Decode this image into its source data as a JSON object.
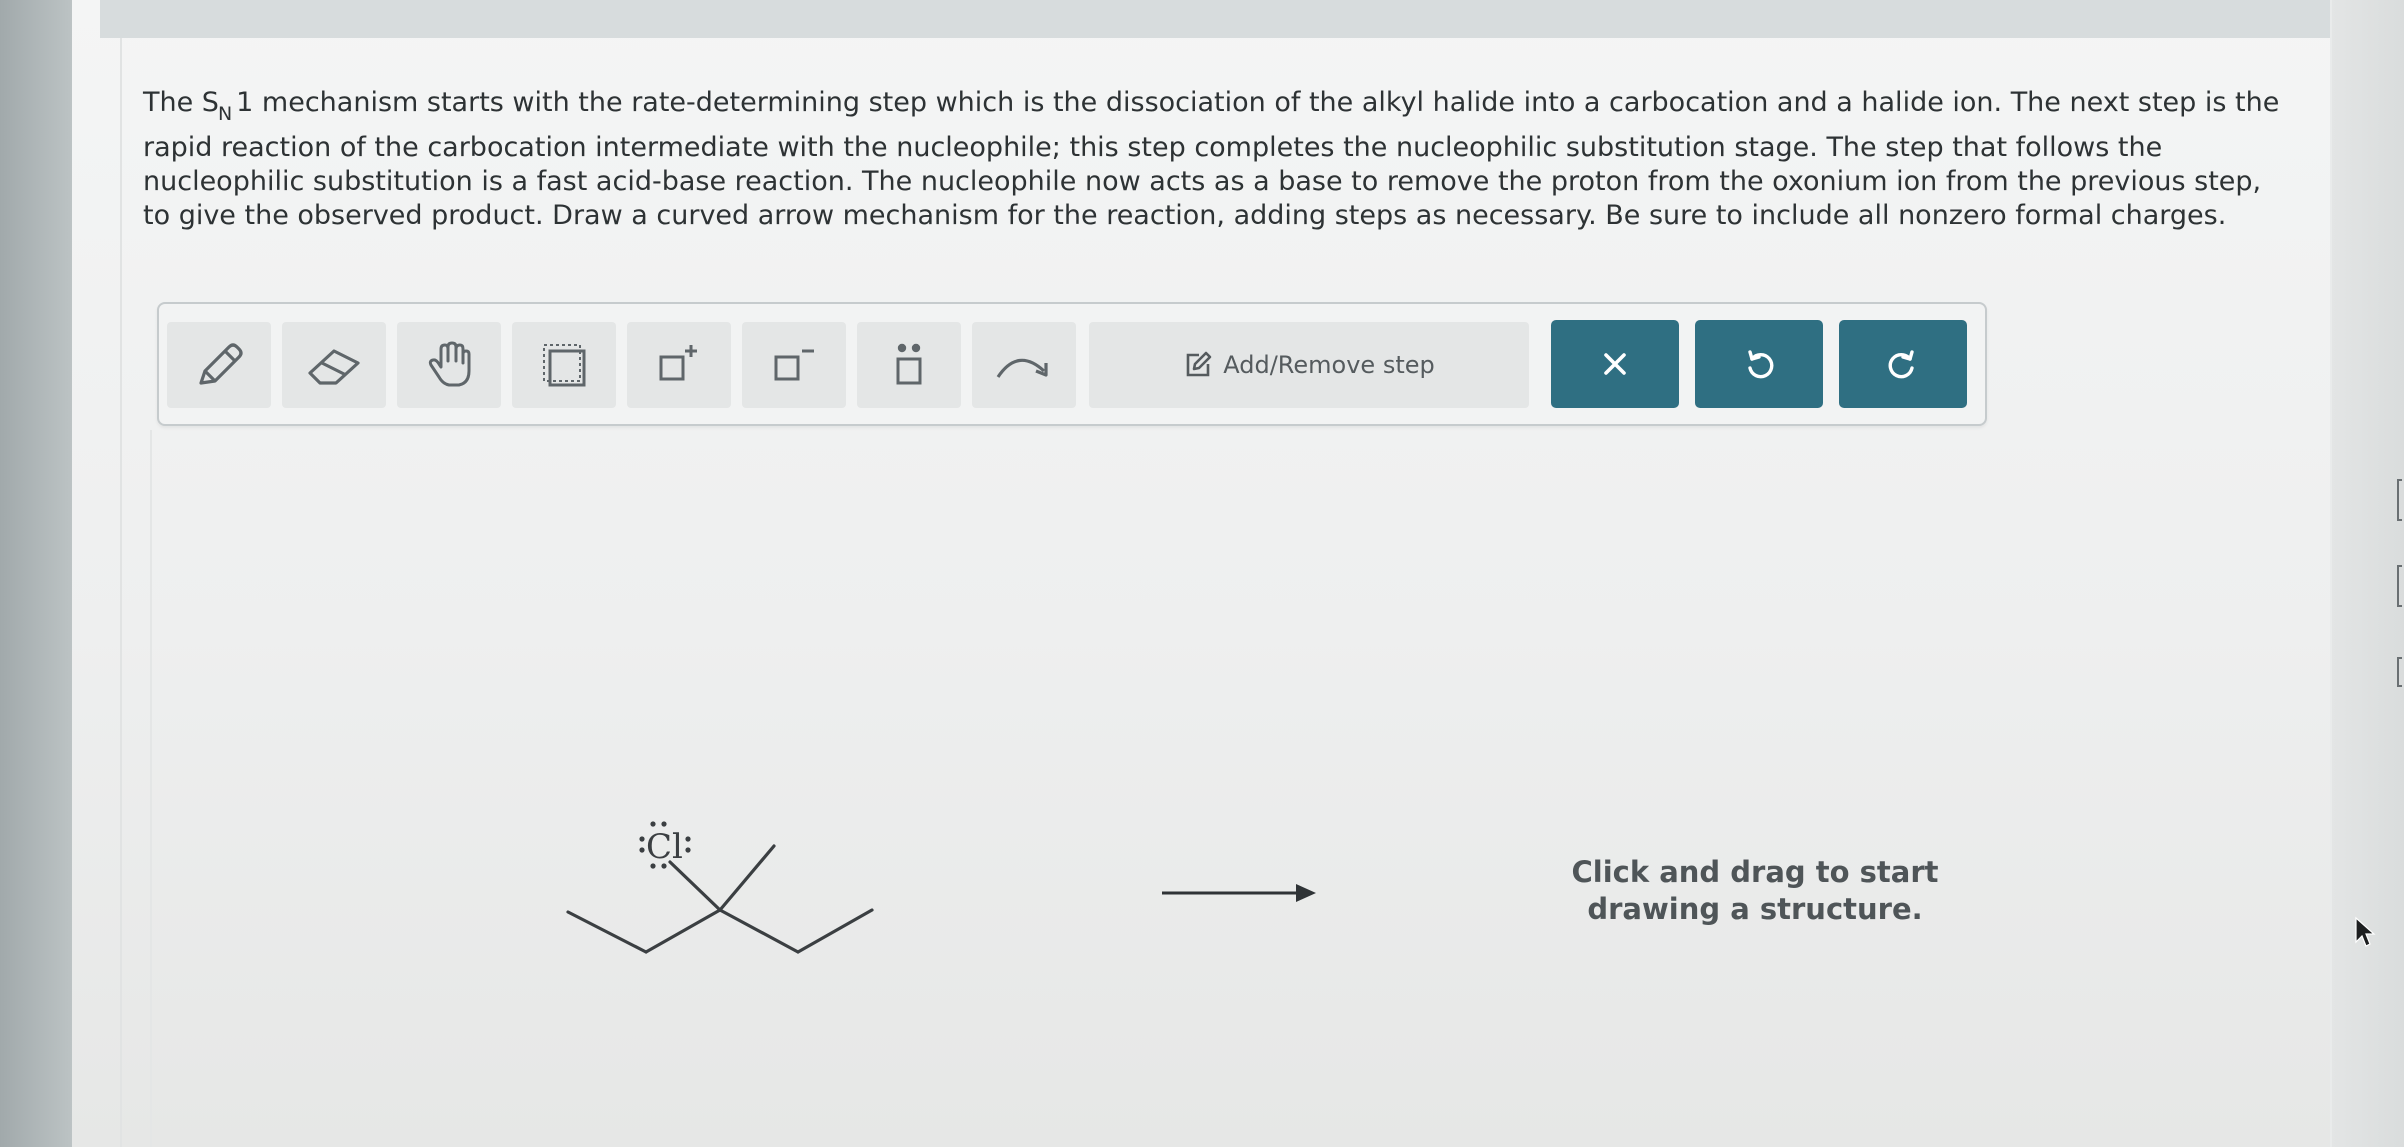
{
  "question": {
    "line_1_pre": "The S",
    "subscript": "N",
    "line_1_post": "1 mechanism starts with the rate-determining step which is the dissociation of the alkyl halide into a carbocation and a halide ion. The next step is the rapid reaction of the carbocation intermediate with the nucleophile; this step completes the nucleophilic substitution stage. The step that follows the nucleophilic substitution is a fast acid-base reaction. The nucleophile now acts as a base to remove the proton from the oxonium ion from the previous step, to give the observed product. Draw a curved arrow mechanism for the reaction, adding steps as necessary. Be sure to include all nonzero formal charges."
  },
  "toolbar": {
    "tools": [
      {
        "name": "pencil",
        "icon": "pencil-icon"
      },
      {
        "name": "eraser",
        "icon": "eraser-icon"
      },
      {
        "name": "hand",
        "icon": "hand-icon"
      },
      {
        "name": "select",
        "icon": "selection-box-icon"
      },
      {
        "name": "positive-charge",
        "icon": "plus-charge-icon"
      },
      {
        "name": "negative-charge",
        "icon": "minus-charge-icon"
      },
      {
        "name": "lone-pair",
        "icon": "lone-pair-icon"
      },
      {
        "name": "curved-arrow",
        "icon": "curved-arrow-icon"
      }
    ],
    "step_label": "Add/Remove step",
    "actions": [
      {
        "name": "clear",
        "icon": "close-icon"
      },
      {
        "name": "undo",
        "icon": "undo-icon"
      },
      {
        "name": "redo",
        "icon": "redo-icon"
      }
    ],
    "accent_color": "#2f6f82"
  },
  "canvas": {
    "molecule_atom_label": "Cl",
    "hint_line_1": "Click and drag to start",
    "hint_line_2": "drawing a structure."
  }
}
